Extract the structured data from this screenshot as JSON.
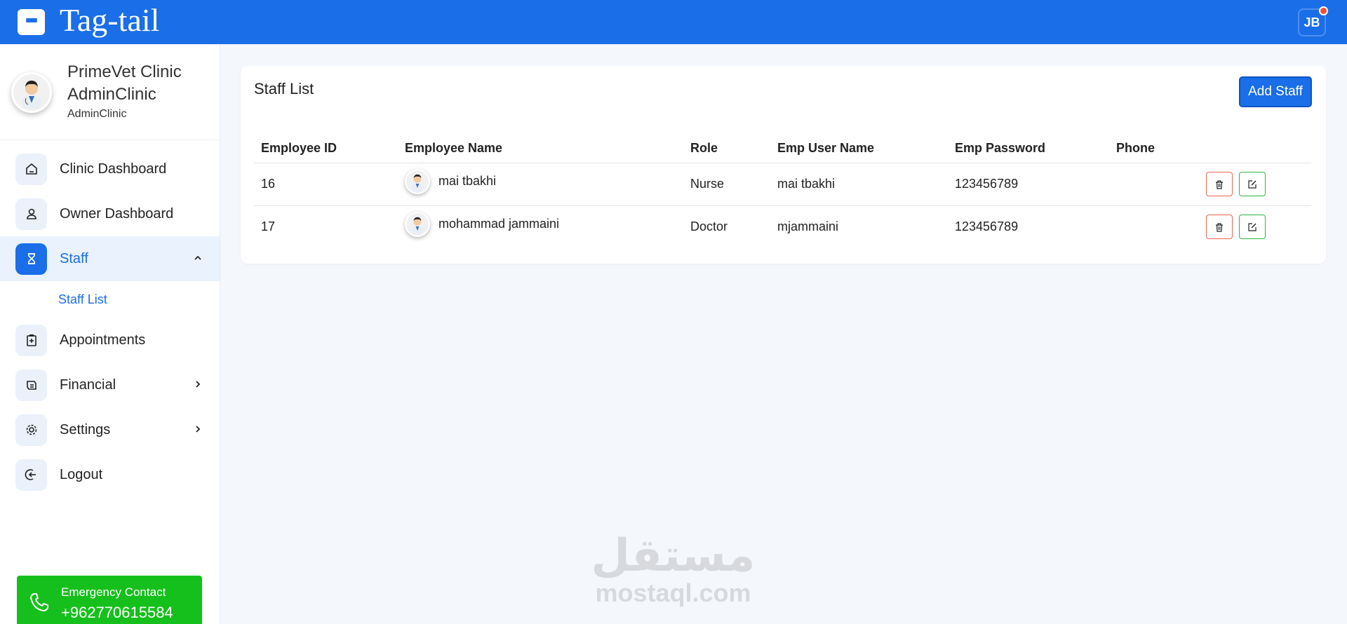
{
  "app": {
    "brand": "Tag-tail",
    "user_initials": "JB"
  },
  "profile": {
    "name": "PrimeVet Clinic AdminClinic",
    "role": "AdminClinic"
  },
  "nav": {
    "items": [
      {
        "label": "Clinic Dashboard",
        "icon": "home-icon"
      },
      {
        "label": "Owner Dashboard",
        "icon": "user-icon"
      },
      {
        "label": "Staff",
        "icon": "hourglass-icon",
        "active": true,
        "expanded": true
      },
      {
        "label": "Appointments",
        "icon": "clipboard-add-icon"
      },
      {
        "label": "Financial",
        "icon": "wallet-icon"
      },
      {
        "label": "Settings",
        "icon": "gear-icon"
      },
      {
        "label": "Logout",
        "icon": "logout-icon"
      }
    ],
    "staff_sub": {
      "label": "Staff List"
    }
  },
  "emergency": {
    "label": "Emergency Contact",
    "number": "+962770615584"
  },
  "card": {
    "title": "Staff List",
    "add_label": "Add Staff",
    "columns": [
      "Employee ID",
      "Employee Name",
      "Role",
      "Emp User Name",
      "Emp Password",
      "Phone"
    ],
    "rows": [
      {
        "id": "16",
        "name": "mai tbakhi",
        "role": "Nurse",
        "username": "mai tbakhi",
        "password": "123456789",
        "phone": ""
      },
      {
        "id": "17",
        "name": "mohammad jammaini",
        "role": "Doctor",
        "username": "mjammaini",
        "password": "123456789",
        "phone": ""
      }
    ]
  },
  "watermark": {
    "arabic": "مستقل",
    "latin": "mostaql.com"
  },
  "colors": {
    "primary": "#1a6ee8",
    "emergency": "#16c01c",
    "delete": "#e8644f",
    "edit": "#2fb540"
  }
}
